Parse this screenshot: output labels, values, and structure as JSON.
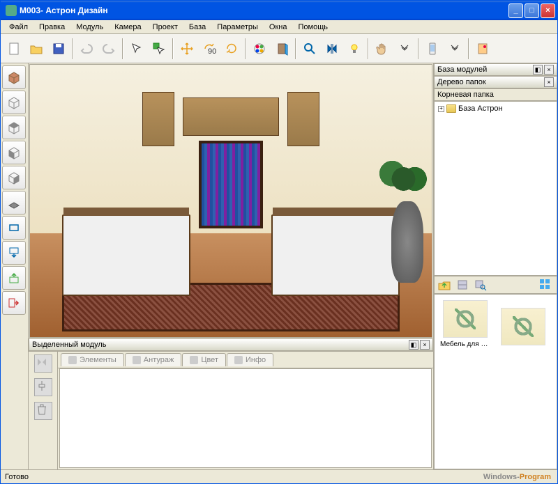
{
  "title": "M003- Астрон Дизайн",
  "menu": [
    "Файл",
    "Правка",
    "Модуль",
    "Камера",
    "Проект",
    "База",
    "Параметры",
    "Окна",
    "Помощь"
  ],
  "toolbar": {
    "items": [
      "new",
      "open",
      "save",
      "undo",
      "redo",
      "select",
      "multi-select",
      "move",
      "rotate-90",
      "rotate",
      "color-wheel",
      "door",
      "zoom",
      "mirror",
      "light",
      "hand",
      "more",
      "mobile",
      "more",
      "export"
    ]
  },
  "left_tools": [
    "cube-solid",
    "cube-wire",
    "cube-top",
    "cube-front",
    "cube-iso",
    "plane",
    "rect",
    "down",
    "up",
    "right"
  ],
  "panels": {
    "selected_module": "Выделенный модуль",
    "module_base": "База модулей",
    "folder_tree": "Дерево папок",
    "root_folder": "Корневая папка",
    "tree_item": "База Астрон"
  },
  "tabs": [
    "Элементы",
    "Антураж",
    "Цвет",
    "Инфо"
  ],
  "thumbs": [
    "Мебель для д...",
    ""
  ],
  "status": "Готово",
  "watermark": {
    "a": "Windows-",
    "b": "Program"
  }
}
